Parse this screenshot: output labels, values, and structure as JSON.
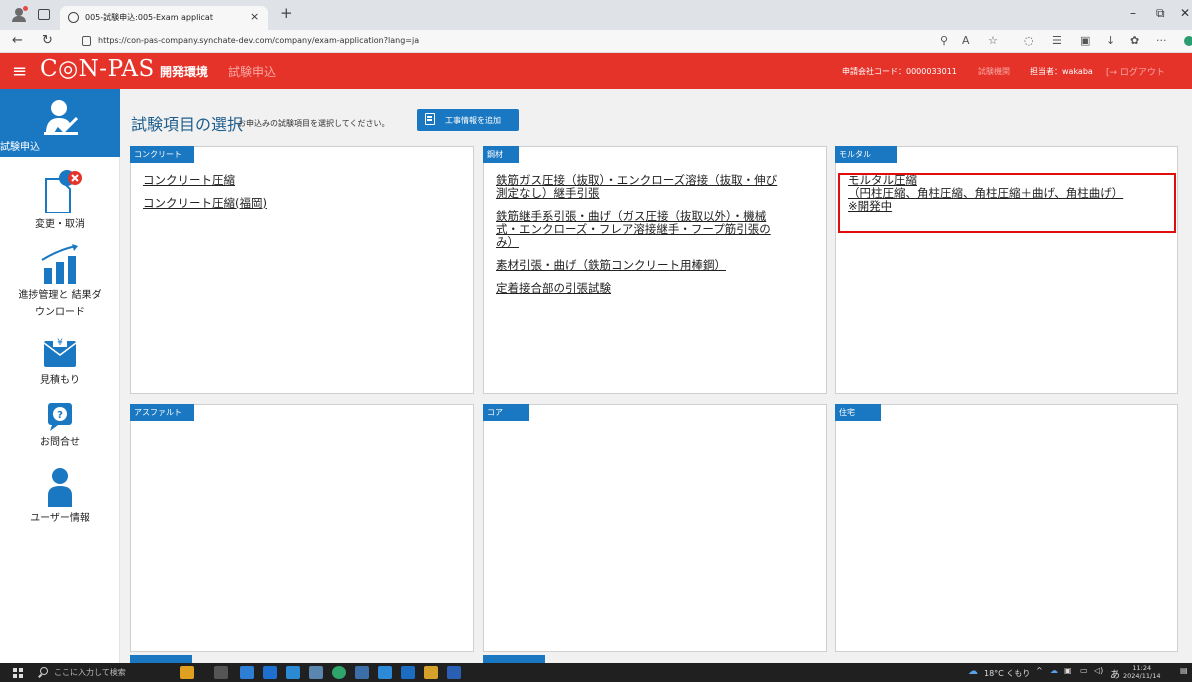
{
  "browser": {
    "tab_title": "005-試験申込:005-Exam applicat",
    "tab_close": "×",
    "new_tab": "+",
    "url": "https://con-pas-company.synchate-dev.com/company/exam-application?lang=ja",
    "window_controls": [
      "–",
      "⧉",
      "✕"
    ]
  },
  "header": {
    "logo": "C◎N-PAS",
    "env_label": "開発環境",
    "page_label": "試験申込",
    "company_code": "申請会社コード：0000033011",
    "gray_label": "試験機関",
    "user": "担当者：wakaba",
    "logout": "ログアウト"
  },
  "sidebar": {
    "items": [
      {
        "label": "試験申込",
        "icon": "person-check-icon"
      },
      {
        "label": "変更・取消",
        "icon": "document-cancel-icon"
      },
      {
        "label": "進捗管理と 結果ダ",
        "label2": "ウンロード",
        "icon": "bar-chart-icon"
      },
      {
        "label": "見積もり",
        "icon": "envelope-yen-icon"
      },
      {
        "label": "お問合せ",
        "icon": "question-bubble-icon"
      },
      {
        "label": "ユーザー情報",
        "icon": "user-icon"
      }
    ]
  },
  "main": {
    "title": "試験項目の選択",
    "subtitle": "お申込みの試験項目を選択してください。",
    "add_button": "工事情報を追加",
    "cards": [
      {
        "header": "コンクリート",
        "links": [
          "コンクリート圧縮",
          "コンクリート圧縮(福岡)"
        ]
      },
      {
        "header": "鋼材",
        "links": [
          [
            "鉄筋ガス圧接（抜取）・エンクローズ溶接（抜取・伸び",
            "測定なし）継手引張"
          ],
          [
            "鉄筋継手系引張・曲げ（ガス圧接（抜取以外）・機械",
            "式・エンクローズ・フレア溶接継手・フープ筋引張の",
            "み）"
          ],
          [
            "素材引張・曲げ（鉄筋コンクリート用棒鋼）"
          ],
          [
            "定着接合部の引張試験"
          ]
        ]
      },
      {
        "header": "モルタル",
        "links": [
          [
            "モルタル圧縮",
            "（円柱圧縮、角柱圧縮、角柱圧縮＋曲げ、角柱曲げ）",
            "※開発中"
          ]
        ]
      },
      {
        "header": "アスファルト",
        "links": []
      },
      {
        "header": "コア",
        "links": []
      },
      {
        "header": "住宅",
        "links": []
      }
    ]
  },
  "taskbar": {
    "search_placeholder": "ここに入力して検索",
    "weather": "18°C くもり",
    "ime": "あ",
    "time": "11:24",
    "date": "2024/11/14"
  }
}
